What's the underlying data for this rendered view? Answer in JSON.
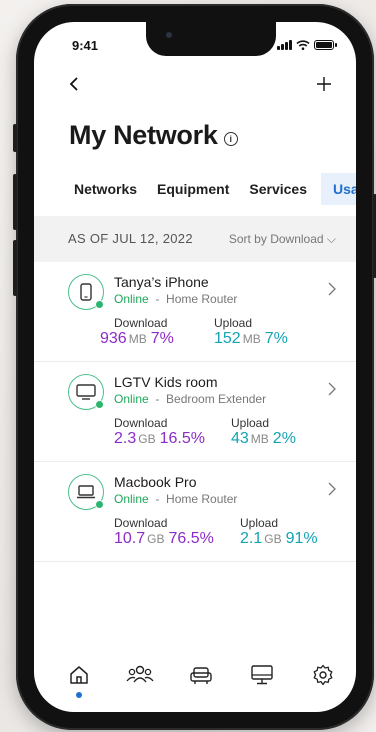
{
  "status": {
    "time": "9:41"
  },
  "header": {
    "title": "My Network",
    "back_icon": "chevron-left-icon",
    "add_icon": "plus-icon"
  },
  "tabs": [
    {
      "label": "Networks",
      "active": false
    },
    {
      "label": "Equipment",
      "active": false
    },
    {
      "label": "Services",
      "active": false
    },
    {
      "label": "Usage",
      "active": true
    }
  ],
  "usage": {
    "as_of": "AS OF JUL 12, 2022",
    "sort_label": "Sort by Download ⌵",
    "devices": [
      {
        "name": "Tanya’s iPhone",
        "status": "Online",
        "separator": "-",
        "location": "Home Router",
        "icon": "phone-icon",
        "download_label": "Download",
        "download_value": "936",
        "download_unit": "MB",
        "download_pct": "7%",
        "upload_label": "Upload",
        "upload_value": "152",
        "upload_unit": "MB",
        "upload_pct": "7%"
      },
      {
        "name": "LGTV Kids room",
        "status": "Online",
        "separator": "-",
        "location": "Bedroom Extender",
        "icon": "tv-icon",
        "download_label": "Download",
        "download_value": "2.3",
        "download_unit": "GB",
        "download_pct": "16.5%",
        "upload_label": "Upload",
        "upload_value": "43",
        "upload_unit": "MB",
        "upload_pct": "2%"
      },
      {
        "name": "Macbook Pro",
        "status": "Online",
        "separator": "-",
        "location": "Home Router",
        "icon": "laptop-icon",
        "download_label": "Download",
        "download_value": "10.7",
        "download_unit": "GB",
        "download_pct": "76.5%",
        "upload_label": "Upload",
        "upload_value": "2.1",
        "upload_unit": "GB",
        "upload_pct": "91%"
      }
    ]
  },
  "bottom_nav": [
    {
      "icon": "home-icon",
      "active": true
    },
    {
      "icon": "people-icon",
      "active": false
    },
    {
      "icon": "sofa-icon",
      "active": false
    },
    {
      "icon": "monitor-icon",
      "active": false
    },
    {
      "icon": "gear-icon",
      "active": false
    }
  ],
  "colors": {
    "accent": "#1f6fd1",
    "online": "#1fa65a",
    "download": "#8c2cc7",
    "upload": "#13a3b3"
  }
}
